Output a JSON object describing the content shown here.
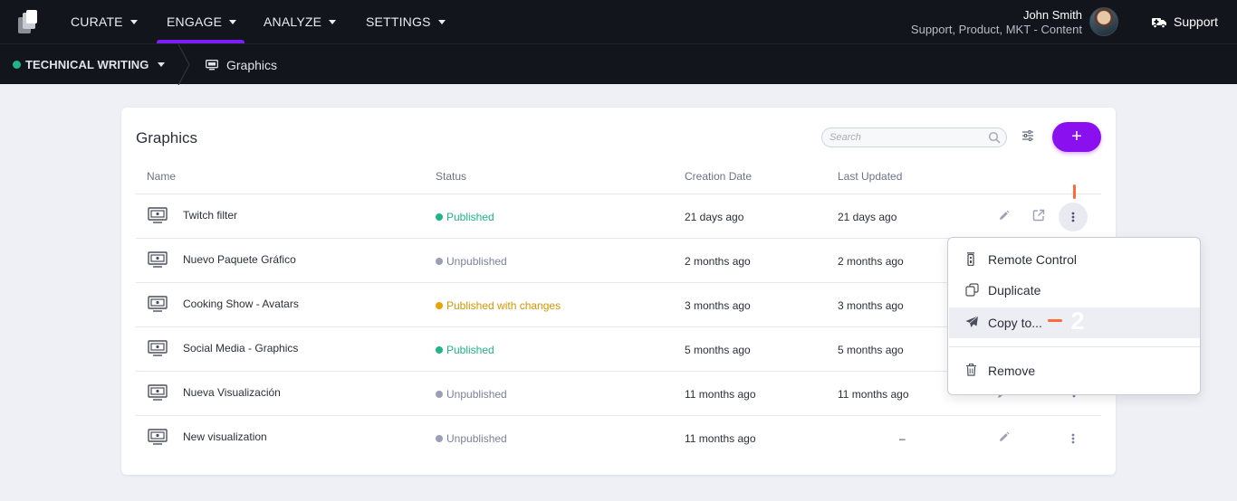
{
  "topnav": {
    "items": [
      {
        "label": "CURATE"
      },
      {
        "label": "ENGAGE",
        "active": true
      },
      {
        "label": "ANALYZE"
      },
      {
        "label": "SETTINGS"
      }
    ],
    "user": {
      "name": "John Smith",
      "role": "Support, Product, MKT - Content"
    },
    "support_label": "Support"
  },
  "breadcrumb": {
    "project": "TECHNICAL WRITING",
    "page": "Graphics"
  },
  "card": {
    "title": "Graphics",
    "search_placeholder": "Search",
    "add_label": "+",
    "columns": {
      "name": "Name",
      "status": "Status",
      "created": "Creation Date",
      "updated": "Last Updated"
    },
    "rows": [
      {
        "name": "Twitch filter",
        "status": "Published",
        "status_color": "#1fb489",
        "created": "21 days ago",
        "updated": "21 days ago"
      },
      {
        "name": "Nuevo Paquete Gráfico",
        "status": "Unpublished",
        "status_color": "#9b9fb8",
        "created": "2 months ago",
        "updated": "2 months ago"
      },
      {
        "name": "Cooking Show - Avatars",
        "status": "Published with changes",
        "status_color": "#eaa400",
        "created": "3 months ago",
        "updated": "3 months ago"
      },
      {
        "name": "Social Media - Graphics",
        "status": "Published",
        "status_color": "#1fb489",
        "created": "5 months ago",
        "updated": "5 months ago"
      },
      {
        "name": "Nueva Visualización",
        "status": "Unpublished",
        "status_color": "#9b9fb8",
        "created": "11 months ago",
        "updated": "11 months ago"
      },
      {
        "name": "New visualization",
        "status": "Unpublished",
        "status_color": "#9b9fb8",
        "created": "11 months ago",
        "updated": "–"
      }
    ]
  },
  "context_menu": {
    "items": [
      {
        "label": "Remote Control",
        "icon": "remote-icon"
      },
      {
        "label": "Duplicate",
        "icon": "duplicate-icon"
      },
      {
        "label": "Copy to...",
        "icon": "send-icon",
        "highlighted": true
      },
      {
        "label": "Remove",
        "icon": "trash-icon"
      }
    ]
  },
  "annotations": {
    "step1": "1",
    "step2": "2"
  },
  "colors": {
    "accent": "#8a10f0",
    "published": "#1fb489",
    "unpublished": "#9b9fb8",
    "changes": "#eaa400",
    "annotation": "#ff6a3a"
  }
}
